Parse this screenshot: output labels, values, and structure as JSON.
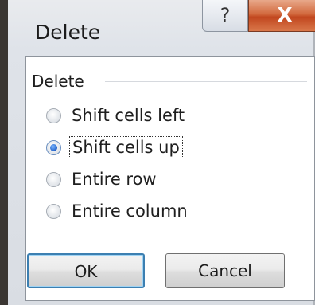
{
  "dialog": {
    "title": "Delete",
    "help_glyph": "?",
    "close_glyph": "X"
  },
  "group": {
    "label": "Delete",
    "options": [
      {
        "label": "Shift cells left",
        "selected": false
      },
      {
        "label": "Shift cells up",
        "selected": true
      },
      {
        "label": "Entire row",
        "selected": false
      },
      {
        "label": "Entire column",
        "selected": false
      }
    ]
  },
  "buttons": {
    "ok_label": "OK",
    "cancel_label": "Cancel"
  }
}
